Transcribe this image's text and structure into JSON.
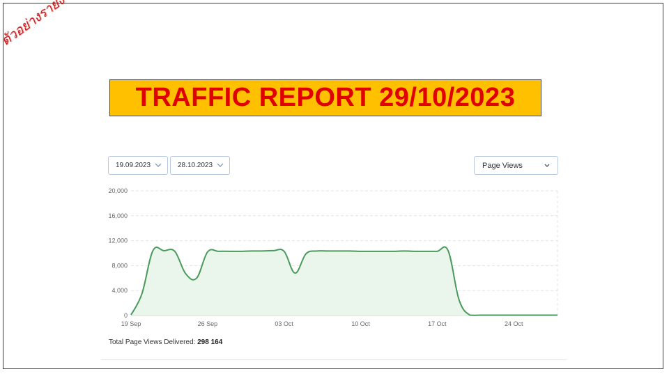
{
  "stamp": "ตัวอย่างรายงาน",
  "title": "TRAFFIC REPORT 29/10/2023",
  "filters": {
    "start_date": "19.09.2023",
    "end_date": "28.10.2023",
    "metric": "Page Views"
  },
  "summary": {
    "label": "Total Page Views Delivered:",
    "value": "298 164"
  },
  "colors": {
    "title_bg": "#ffc000",
    "title_text": "#e00000",
    "stamp": "#d0191a",
    "line": "#4a9a5c",
    "area": "#eaf5ec"
  },
  "chart_data": {
    "type": "area",
    "ylim": [
      0,
      20000
    ],
    "yticks": [
      "20,000",
      "16,000",
      "12,000",
      "8,000",
      "4,000",
      "0"
    ],
    "ytick_values": [
      20000,
      16000,
      12000,
      8000,
      4000,
      0
    ],
    "xtick_labels": [
      "19 Sep",
      "26 Sep",
      "03 Oct",
      "10 Oct",
      "17 Oct",
      "24 Oct"
    ],
    "xtick_days": [
      0,
      7,
      14,
      21,
      28,
      35
    ],
    "x_days_range": [
      0,
      39
    ],
    "grid": true,
    "series": [
      {
        "x": [
          0,
          1,
          2,
          3,
          4,
          5,
          6,
          7,
          8,
          9,
          10,
          11,
          12,
          13,
          14,
          15,
          16,
          17,
          18,
          19,
          20,
          21,
          22,
          23,
          24,
          25,
          26,
          27,
          28,
          29,
          30,
          31,
          32,
          33,
          34,
          35,
          36,
          37,
          38,
          39
        ],
        "y": [
          100,
          3500,
          10400,
          10400,
          10300,
          6700,
          6000,
          10200,
          10300,
          10300,
          10300,
          10350,
          10350,
          10400,
          10300,
          6800,
          9900,
          10350,
          10350,
          10350,
          10350,
          10300,
          10300,
          10300,
          10300,
          10350,
          10300,
          10300,
          10300,
          10400,
          2500,
          50,
          50,
          50,
          50,
          50,
          50,
          50,
          50,
          50
        ]
      }
    ]
  }
}
